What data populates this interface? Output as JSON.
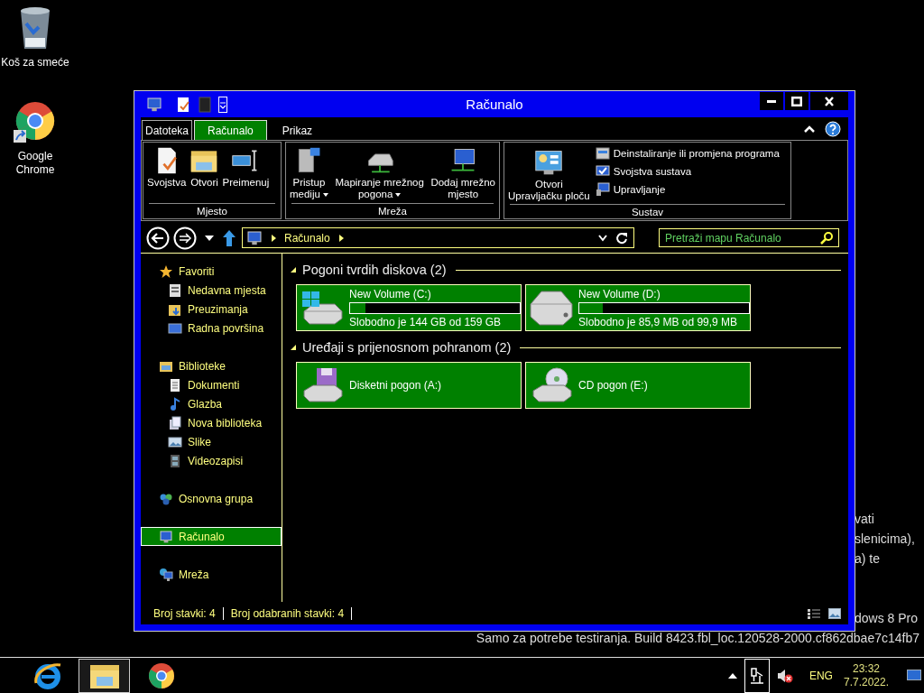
{
  "desktop_icons": [
    {
      "kind": "trash",
      "label": "Koš za smeće"
    },
    {
      "kind": "chrome",
      "label": "Google Chrome"
    }
  ],
  "desktop_text": [
    "vati",
    "slenicima),",
    "a) te",
    "dows 8 Pro",
    "Samo za potrebe testiranja. Build 8423.fbl_loc.120528-2000.cf862dbae7c14fb7"
  ],
  "window": {
    "title": "Računalo"
  },
  "ribbon_tabs": [
    {
      "label": "Datoteka",
      "selected": false
    },
    {
      "label": "Računalo",
      "selected": true
    },
    {
      "label": "Prikaz",
      "selected": false
    }
  ],
  "ribbon_groups": [
    {
      "label": "Mjesto",
      "commands": [
        {
          "kind": "large",
          "lines": [
            "Svojstva"
          ],
          "dropdown": false
        },
        {
          "kind": "large",
          "lines": [
            "Otvori"
          ],
          "dropdown": false
        },
        {
          "kind": "large",
          "lines": [
            "Preimenuj"
          ],
          "dropdown": false
        }
      ]
    },
    {
      "label": "Mreža",
      "commands": [
        {
          "kind": "large",
          "lines": [
            "Pristup",
            "mediju"
          ],
          "dropdown": true
        },
        {
          "kind": "large",
          "lines": [
            "Mapiranje mrežnog",
            "pogona"
          ],
          "dropdown": true
        },
        {
          "kind": "large",
          "lines": [
            "Dodaj mrežno",
            "mjesto"
          ],
          "dropdown": false
        }
      ]
    },
    {
      "label": "Sustav",
      "commands": [
        {
          "kind": "large",
          "lines": [
            "Otvori",
            "Upravljačku ploču"
          ],
          "dropdown": false
        },
        {
          "kind": "small",
          "lines": [
            "Deinstaliranje ili promjena programa"
          ],
          "dropdown": false
        },
        {
          "kind": "small",
          "lines": [
            "Svojstva sustava"
          ],
          "dropdown": false
        },
        {
          "kind": "small",
          "lines": [
            "Upravljanje"
          ],
          "dropdown": false
        }
      ]
    }
  ],
  "address": {
    "path": [
      "Računalo"
    ]
  },
  "search": {
    "placeholder": "Pretraži mapu Računalo"
  },
  "navigation": [
    {
      "label": "Favoriti",
      "selected": false,
      "children": [
        {
          "label": "Nedavna mjesta",
          "selected": false
        },
        {
          "label": "Preuzimanja",
          "selected": false
        },
        {
          "label": "Radna površina",
          "selected": false
        }
      ]
    },
    {
      "label": "Biblioteke",
      "selected": false,
      "children": [
        {
          "label": "Dokumenti",
          "selected": false
        },
        {
          "label": "Glazba",
          "selected": false
        },
        {
          "label": "Nova biblioteka",
          "selected": false
        },
        {
          "label": "Slike",
          "selected": false
        },
        {
          "label": "Videozapisi",
          "selected": false
        }
      ]
    },
    {
      "label": "Osnovna grupa",
      "selected": false
    },
    {
      "label": "Računalo",
      "selected": true
    },
    {
      "label": "Mreža",
      "selected": false
    }
  ],
  "groups": [
    {
      "title": "Pogoni tvrdih diskova (2)",
      "expanded": true,
      "items": [
        {
          "kind": "system-disk",
          "name": "New Volume (C:)",
          "selected": true,
          "level": 0.09,
          "free": "Slobodno je 144 GB od 159 GB"
        },
        {
          "kind": "disk",
          "name": "New Volume (D:)",
          "selected": true,
          "level": 0.14,
          "free": "Slobodno je 85,9 MB od 99,9 MB"
        }
      ]
    },
    {
      "title": "Uređaji s prijenosnom pohranom (2)",
      "expanded": true,
      "items": [
        {
          "kind": "floppy",
          "name": "Disketni pogon (A:)",
          "selected": true
        },
        {
          "kind": "cd",
          "name": "CD pogon (E:)",
          "selected": true
        }
      ]
    }
  ],
  "status_bar": [
    "Broj stavki: 4",
    "Broj odabranih stavki: 4"
  ],
  "taskbar": {
    "apps": [
      {
        "kind": "ie",
        "selected": false
      },
      {
        "kind": "explorer",
        "selected": true
      },
      {
        "kind": "chrome",
        "selected": false
      }
    ],
    "tray_icons": [
      {
        "kind": "overflow",
        "highlighted": false
      },
      {
        "kind": "network",
        "highlighted": true
      },
      {
        "kind": "volume-muted",
        "highlighted": false
      }
    ],
    "language": "ENG",
    "time": "23:32",
    "date": "7.7.2022."
  }
}
